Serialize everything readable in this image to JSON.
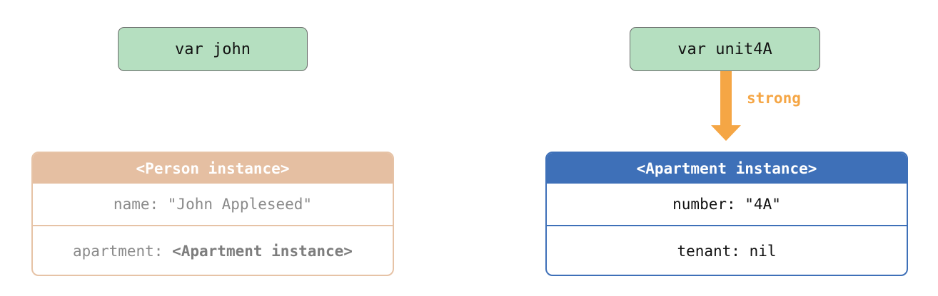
{
  "variables": {
    "john": "var john",
    "unit4a": "var unit4A"
  },
  "person_instance": {
    "title": "<Person instance>",
    "name_row": "name: \"John Appleseed\"",
    "apartment_key": "apartment: ",
    "apartment_value": "<Apartment instance>"
  },
  "apartment_instance": {
    "title": "<Apartment instance>",
    "number_row": "number: \"4A\"",
    "tenant_row": "tenant: nil"
  },
  "references": {
    "unit4a_to_apartment": "strong"
  },
  "colors": {
    "variable_fill": "#b5dfc0",
    "person_header": "#e5bfa2",
    "apartment_header": "#3e70b8",
    "strong_reference": "#f5a645"
  }
}
